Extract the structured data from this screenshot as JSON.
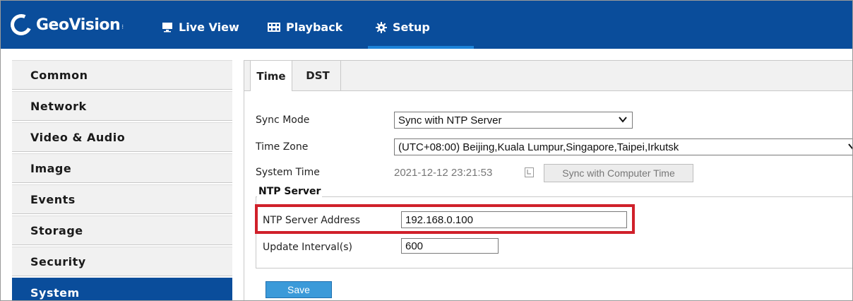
{
  "app": {
    "brand": "GeoVision",
    "nav": {
      "live_view": "Live View",
      "playback": "Playback",
      "setup": "Setup"
    }
  },
  "sidebar": {
    "items": [
      {
        "label": "Common",
        "active": false
      },
      {
        "label": "Network",
        "active": false
      },
      {
        "label": "Video & Audio",
        "active": false
      },
      {
        "label": "Image",
        "active": false
      },
      {
        "label": "Events",
        "active": false
      },
      {
        "label": "Storage",
        "active": false
      },
      {
        "label": "Security",
        "active": false
      },
      {
        "label": "System",
        "active": true
      }
    ]
  },
  "tabs": {
    "time": "Time",
    "dst": "DST",
    "active": "Time"
  },
  "form": {
    "sync_mode": {
      "label": "Sync Mode",
      "value": "Sync with NTP Server"
    },
    "time_zone": {
      "label": "Time Zone",
      "value": "(UTC+08:00) Beijing,Kuala Lumpur,Singapore,Taipei,Irkutsk"
    },
    "system_time": {
      "label": "System Time",
      "value": "2021-12-12 23:21:53",
      "sync_button": "Sync with Computer Time"
    },
    "ntp_group": {
      "legend": "NTP Server",
      "server_address": {
        "label": "NTP Server Address",
        "value": "192.168.0.100"
      },
      "update_interval": {
        "label": "Update Interval(s)",
        "value": "600"
      }
    },
    "save_label": "Save"
  },
  "colors": {
    "topbar": "#0a4d9b",
    "sidebar_active": "#0a4d9b",
    "highlight": "#d0202a",
    "save_button": "#3b9ad9"
  }
}
